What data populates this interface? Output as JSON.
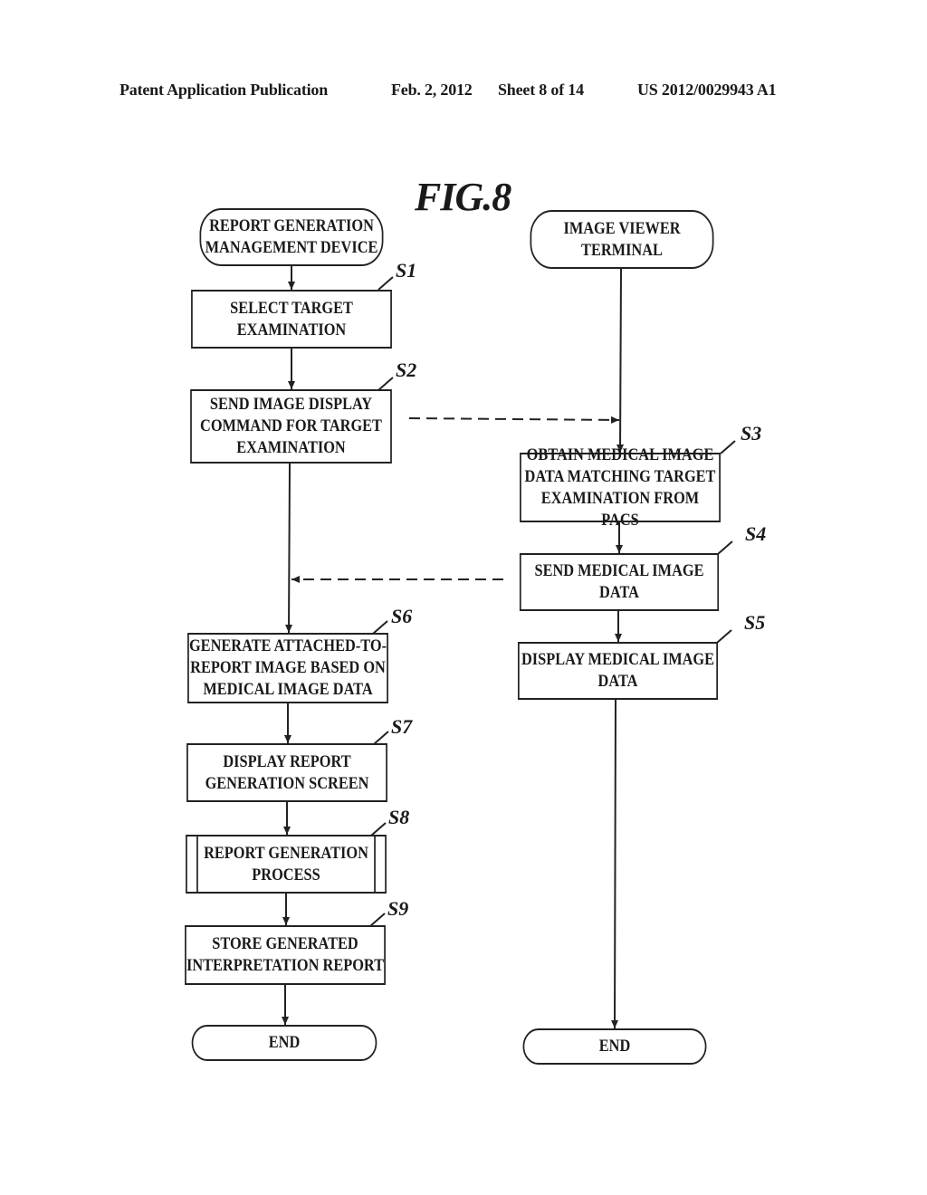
{
  "header": {
    "publication": "Patent Application Publication",
    "date": "Feb. 2, 2012",
    "sheet": "Sheet 8 of 14",
    "number": "US 2012/0029943 A1"
  },
  "figure": {
    "title": "FIG.8"
  },
  "left_column": {
    "start": "REPORT GENERATION\nMANAGEMENT DEVICE",
    "steps": [
      {
        "id": "S1",
        "text": "SELECT TARGET\nEXAMINATION"
      },
      {
        "id": "S2",
        "text": "SEND IMAGE DISPLAY\nCOMMAND FOR TARGET\nEXAMINATION"
      },
      {
        "id": "S6",
        "text": "GENERATE ATTACHED-TO-\nREPORT IMAGE BASED ON\nMEDICAL  IMAGE DATA"
      },
      {
        "id": "S7",
        "text": "DISPLAY REPORT\nGENERATION SCREEN"
      },
      {
        "id": "S8",
        "text": "REPORT GENERATION\nPROCESS"
      },
      {
        "id": "S9",
        "text": "STORE GENERATED\nINTERPRETATION REPORT"
      }
    ],
    "end": "END"
  },
  "right_column": {
    "start": "IMAGE VIEWER\nTERMINAL",
    "steps": [
      {
        "id": "S3",
        "text": "OBTAIN MEDICAL IMAGE\nDATA MATCHING TARGET\nEXAMINATION FROM PACS"
      },
      {
        "id": "S4",
        "text": "SEND MEDICAL IMAGE DATA"
      },
      {
        "id": "S5",
        "text": "DISPLAY MEDICAL IMAGE\nDATA"
      }
    ],
    "end": "END"
  },
  "messages": [
    {
      "from": "S2",
      "to": "image-viewer-terminal-flow",
      "style": "dashed"
    },
    {
      "from": "S4",
      "to": "report-generation-flow",
      "style": "dashed"
    }
  ]
}
